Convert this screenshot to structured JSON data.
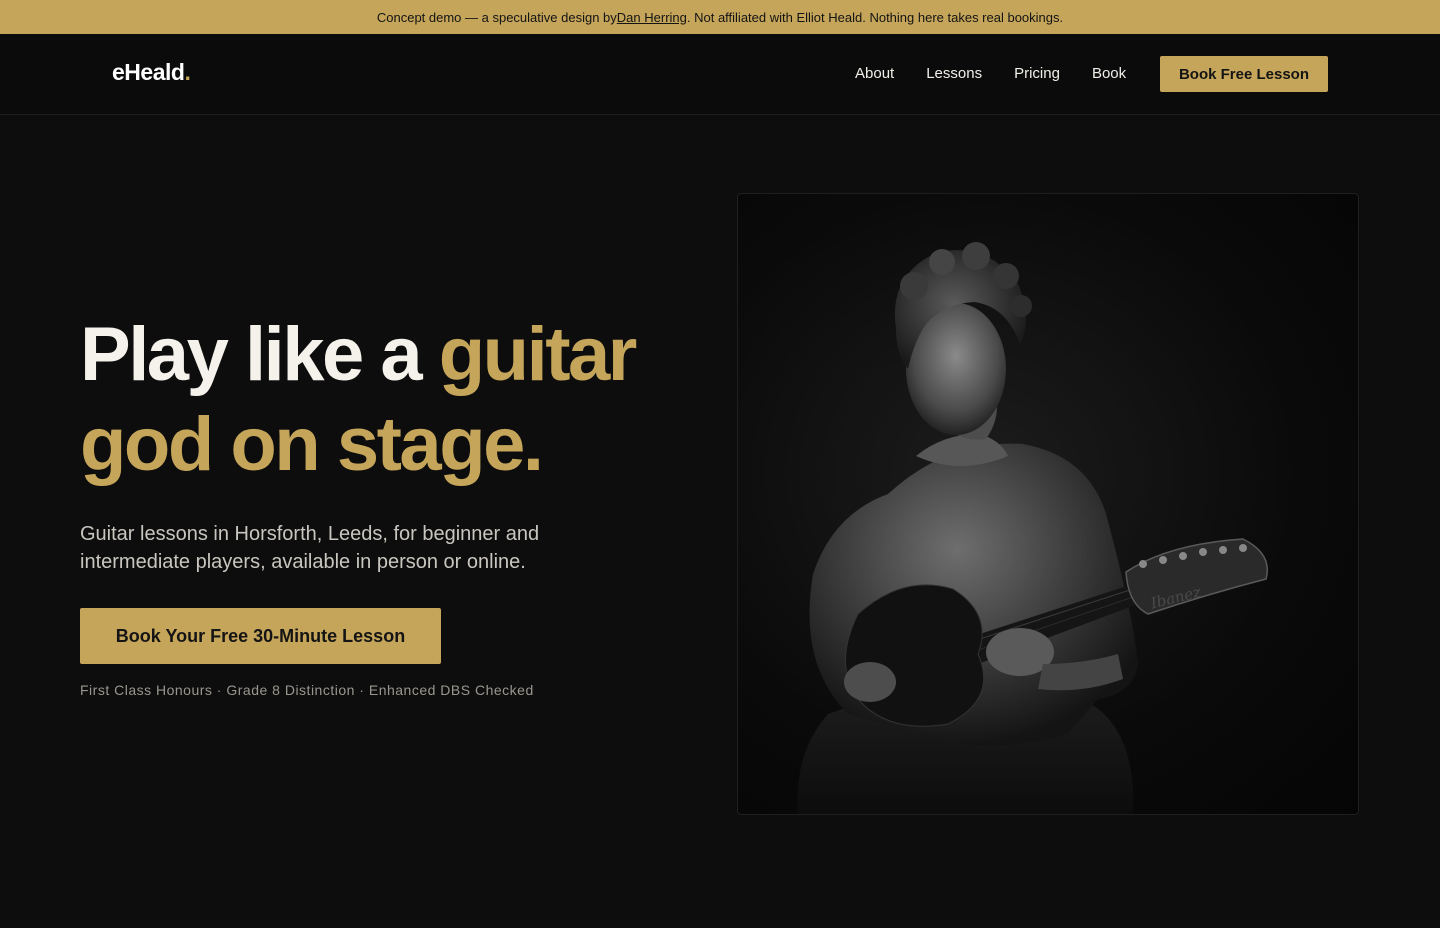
{
  "notice": {
    "prefix": "Concept demo — a speculative design by ",
    "author_link": "Dan Herring",
    "suffix": ". Not affiliated with Elliot Heald. Nothing here takes real bookings."
  },
  "nav": {
    "logo": "eHeald",
    "logo_dot": ".",
    "links": [
      "About",
      "Lessons",
      "Pricing",
      "Book"
    ],
    "cta": "Book Free Lesson"
  },
  "hero": {
    "title_white": "Play like a ",
    "title_gold_1": "guitar",
    "title_gold_2": "god on stage.",
    "subtitle": "Guitar lessons in Horsforth, Leeds, for beginner and intermediate players, available in person or online.",
    "cta": "Book Your Free 30-Minute Lesson",
    "credentials": "First Class Honours · Grade 8 Distinction · Enhanced DBS Checked",
    "photo_headstock_text": "Ibanez"
  },
  "colors": {
    "accent": "#c5a55a",
    "background": "#0d0d0d",
    "text": "#f2efe9",
    "muted": "#9a968f"
  },
  "icons": {
    "photo": "guitarist-portrait"
  }
}
